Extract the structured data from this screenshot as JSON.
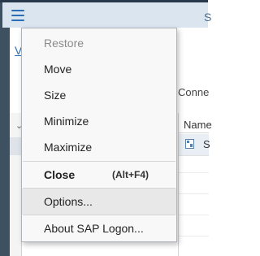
{
  "titlebar": {
    "title_fragment": "S"
  },
  "background": {
    "link_fragment": "V",
    "connections_fragment": "Conne",
    "table": {
      "header": "Name",
      "cell": "S"
    }
  },
  "system_menu": {
    "items": [
      {
        "label": "Restore",
        "state": "disabled"
      },
      {
        "label": "Move",
        "state": "normal"
      },
      {
        "label": "Size",
        "state": "normal"
      },
      {
        "label": "Minimize",
        "state": "normal"
      },
      {
        "label": "Maximize",
        "state": "normal"
      },
      {
        "label": "Close",
        "shortcut": "(Alt+F4)",
        "state": "bold"
      },
      {
        "label": "Options...",
        "state": "hovered"
      },
      {
        "label": "About SAP Logon...",
        "state": "normal"
      }
    ]
  },
  "colors": {
    "accent": "#2a6fb5",
    "titlebar": "#dbe5f0",
    "menu_bg": "#f8f8f8",
    "hover": "#e8e8e8"
  }
}
